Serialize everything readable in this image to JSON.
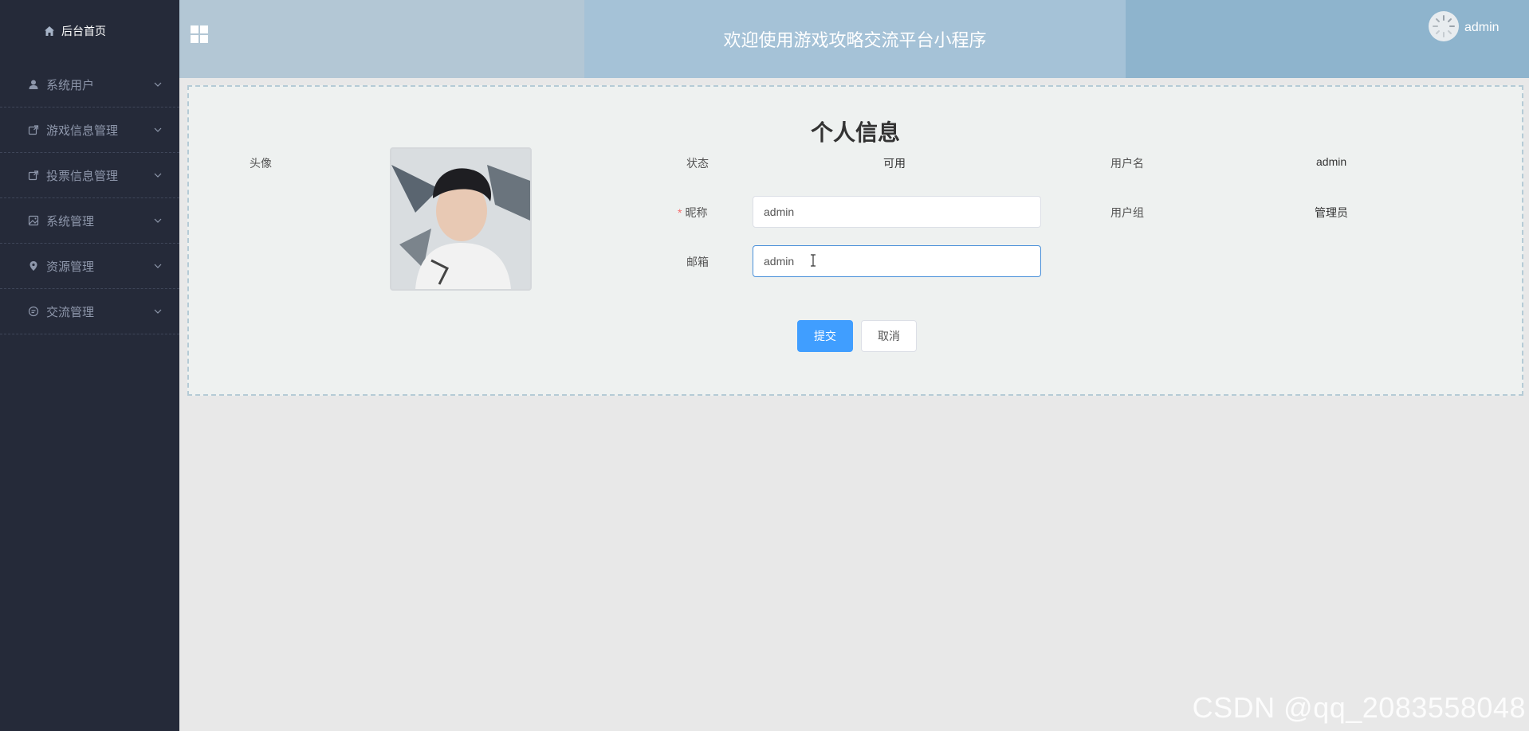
{
  "sidebar": {
    "home": {
      "label": "后台首页",
      "icon": "home-icon"
    },
    "items": [
      {
        "label": "系统用户",
        "icon": "user-icon"
      },
      {
        "label": "游戏信息管理",
        "icon": "share-square-icon"
      },
      {
        "label": "投票信息管理",
        "icon": "share-square-icon"
      },
      {
        "label": "系统管理",
        "icon": "picture-icon"
      },
      {
        "label": "资源管理",
        "icon": "location-pin-icon"
      },
      {
        "label": "交流管理",
        "icon": "chat-bubble-icon"
      }
    ]
  },
  "header": {
    "title": "欢迎使用游戏攻略交流平台小程序",
    "user": "admin"
  },
  "profile": {
    "title": "个人信息",
    "avatar_label": "头像",
    "status_label": "状态",
    "status_value": "可用",
    "username_label": "用户名",
    "username_value": "admin",
    "nickname_label": "昵称",
    "nickname_value": "admin",
    "usergroup_label": "用户组",
    "usergroup_value": "管理员",
    "email_label": "邮箱",
    "email_value": "admin",
    "submit_label": "提交",
    "cancel_label": "取消"
  },
  "watermark": "CSDN @qq_2083558048",
  "colors": {
    "sidebar_bg": "#252a39",
    "primary": "#409eff",
    "required": "#f56c6c"
  }
}
